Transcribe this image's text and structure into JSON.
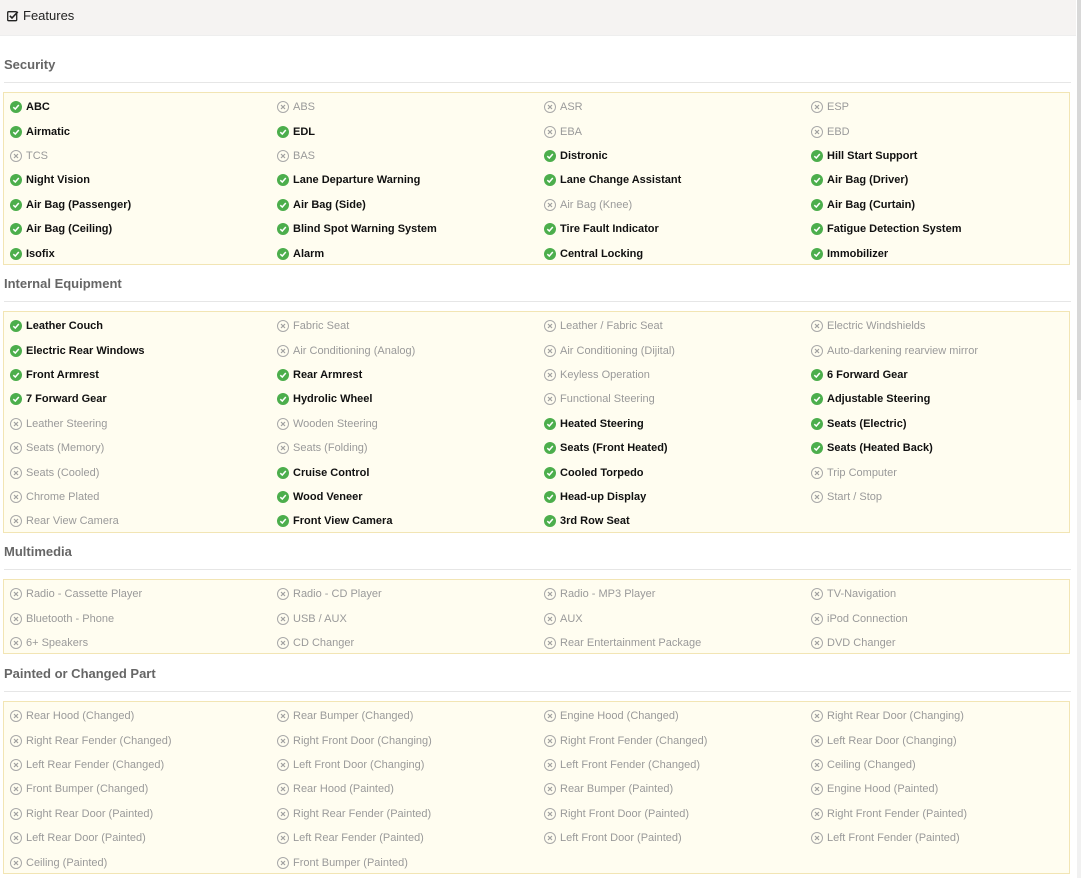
{
  "header": {
    "title": "Features",
    "icon": "check-square-icon"
  },
  "colors": {
    "available": "#4cae4c",
    "unavailable": "#a9a9a9",
    "panel_bg": "#fffdf0",
    "panel_border": "#f2e5b4"
  },
  "sections": [
    {
      "title": "Security",
      "items": [
        {
          "label": "ABC",
          "on": true
        },
        {
          "label": "ABS",
          "on": false
        },
        {
          "label": "ASR",
          "on": false
        },
        {
          "label": "ESP",
          "on": false
        },
        {
          "label": "Airmatic",
          "on": true
        },
        {
          "label": "EDL",
          "on": true
        },
        {
          "label": "EBA",
          "on": false
        },
        {
          "label": "EBD",
          "on": false
        },
        {
          "label": "TCS",
          "on": false
        },
        {
          "label": "BAS",
          "on": false
        },
        {
          "label": "Distronic",
          "on": true
        },
        {
          "label": "Hill Start Support",
          "on": true
        },
        {
          "label": "Night Vision",
          "on": true
        },
        {
          "label": "Lane Departure Warning",
          "on": true
        },
        {
          "label": "Lane Change Assistant",
          "on": true
        },
        {
          "label": "Air Bag (Driver)",
          "on": true
        },
        {
          "label": "Air Bag (Passenger)",
          "on": true
        },
        {
          "label": "Air Bag (Side)",
          "on": true
        },
        {
          "label": "Air Bag (Knee)",
          "on": false
        },
        {
          "label": "Air Bag (Curtain)",
          "on": true
        },
        {
          "label": "Air Bag (Ceiling)",
          "on": true
        },
        {
          "label": "Blind Spot Warning System",
          "on": true
        },
        {
          "label": "Tire Fault Indicator",
          "on": true
        },
        {
          "label": "Fatigue Detection System",
          "on": true
        },
        {
          "label": "Isofix",
          "on": true
        },
        {
          "label": "Alarm",
          "on": true
        },
        {
          "label": "Central Locking",
          "on": true
        },
        {
          "label": "Immobilizer",
          "on": true
        }
      ]
    },
    {
      "title": "Internal Equipment",
      "items": [
        {
          "label": "Leather Couch",
          "on": true
        },
        {
          "label": "Fabric Seat",
          "on": false
        },
        {
          "label": "Leather / Fabric Seat",
          "on": false
        },
        {
          "label": "Electric Windshields",
          "on": false
        },
        {
          "label": "Electric Rear Windows",
          "on": true
        },
        {
          "label": "Air Conditioning (Analog)",
          "on": false
        },
        {
          "label": "Air Conditioning (Dijital)",
          "on": false
        },
        {
          "label": "Auto-darkening rearview mirror",
          "on": false
        },
        {
          "label": "Front Armrest",
          "on": true
        },
        {
          "label": "Rear Armrest",
          "on": true
        },
        {
          "label": "Keyless Operation",
          "on": false
        },
        {
          "label": "6 Forward Gear",
          "on": true
        },
        {
          "label": "7 Forward Gear",
          "on": true
        },
        {
          "label": "Hydrolic Wheel",
          "on": true
        },
        {
          "label": "Functional Steering",
          "on": false
        },
        {
          "label": "Adjustable Steering",
          "on": true
        },
        {
          "label": "Leather Steering",
          "on": false
        },
        {
          "label": "Wooden Steering",
          "on": false
        },
        {
          "label": "Heated Steering",
          "on": true
        },
        {
          "label": "Seats (Electric)",
          "on": true
        },
        {
          "label": "Seats (Memory)",
          "on": false
        },
        {
          "label": "Seats (Folding)",
          "on": false
        },
        {
          "label": "Seats (Front Heated)",
          "on": true
        },
        {
          "label": "Seats (Heated Back)",
          "on": true
        },
        {
          "label": "Seats (Cooled)",
          "on": false
        },
        {
          "label": "Cruise Control",
          "on": true
        },
        {
          "label": "Cooled Torpedo",
          "on": true
        },
        {
          "label": "Trip Computer",
          "on": false
        },
        {
          "label": "Chrome Plated",
          "on": false
        },
        {
          "label": "Wood Veneer",
          "on": true
        },
        {
          "label": "Head-up Display",
          "on": true
        },
        {
          "label": "Start / Stop",
          "on": false
        },
        {
          "label": "Rear View Camera",
          "on": false
        },
        {
          "label": "Front View Camera",
          "on": true
        },
        {
          "label": "3rd Row Seat",
          "on": true
        }
      ]
    },
    {
      "title": "Multimedia",
      "items": [
        {
          "label": "Radio - Cassette Player",
          "on": false
        },
        {
          "label": "Radio - CD Player",
          "on": false
        },
        {
          "label": "Radio - MP3 Player",
          "on": false
        },
        {
          "label": "TV-Navigation",
          "on": false
        },
        {
          "label": "Bluetooth - Phone",
          "on": false
        },
        {
          "label": "USB / AUX",
          "on": false
        },
        {
          "label": "AUX",
          "on": false
        },
        {
          "label": "iPod Connection",
          "on": false
        },
        {
          "label": "6+ Speakers",
          "on": false
        },
        {
          "label": "CD Changer",
          "on": false
        },
        {
          "label": "Rear Entertainment Package",
          "on": false
        },
        {
          "label": "DVD Changer",
          "on": false
        }
      ]
    },
    {
      "title": "Painted or Changed Part",
      "items": [
        {
          "label": "Rear Hood (Changed)",
          "on": false
        },
        {
          "label": "Rear Bumper (Changed)",
          "on": false
        },
        {
          "label": "Engine Hood (Changed)",
          "on": false
        },
        {
          "label": "Right Rear Door (Changing)",
          "on": false
        },
        {
          "label": "Right Rear Fender (Changed)",
          "on": false
        },
        {
          "label": "Right Front Door (Changing)",
          "on": false
        },
        {
          "label": "Right Front Fender (Changed)",
          "on": false
        },
        {
          "label": "Left Rear Door (Changing)",
          "on": false
        },
        {
          "label": "Left Rear Fender (Changed)",
          "on": false
        },
        {
          "label": "Left Front Door (Changing)",
          "on": false
        },
        {
          "label": "Left Front Fender (Changed)",
          "on": false
        },
        {
          "label": "Ceiling (Changed)",
          "on": false
        },
        {
          "label": "Front Bumper (Changed)",
          "on": false
        },
        {
          "label": "Rear Hood (Painted)",
          "on": false
        },
        {
          "label": "Rear Bumper (Painted)",
          "on": false
        },
        {
          "label": "Engine Hood (Painted)",
          "on": false
        },
        {
          "label": "Right Rear Door (Painted)",
          "on": false
        },
        {
          "label": "Right Rear Fender (Painted)",
          "on": false
        },
        {
          "label": "Right Front Door (Painted)",
          "on": false
        },
        {
          "label": "Right Front Fender (Painted)",
          "on": false
        },
        {
          "label": "Left Rear Door (Painted)",
          "on": false
        },
        {
          "label": "Left Rear Fender (Painted)",
          "on": false
        },
        {
          "label": "Left Front Door (Painted)",
          "on": false
        },
        {
          "label": "Left Front Fender (Painted)",
          "on": false
        },
        {
          "label": "Ceiling (Painted)",
          "on": false
        },
        {
          "label": "Front Bumper (Painted)",
          "on": false
        }
      ]
    }
  ]
}
